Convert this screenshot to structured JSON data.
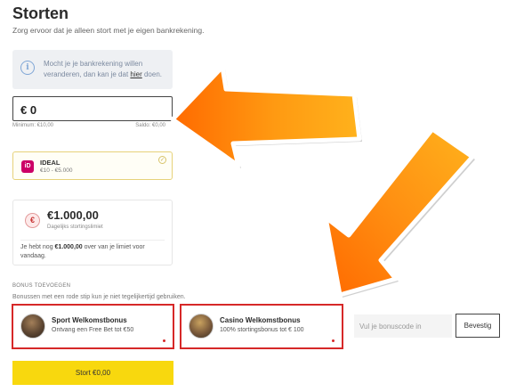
{
  "header": {
    "title": "Storten",
    "subtitle": "Zorg ervoor dat je alleen stort met je eigen bankrekening."
  },
  "info": {
    "text_before": "Mocht je je bankrekening willen veranderen, dan kan je dat ",
    "link": "hier",
    "text_after": " doen.",
    "icon": "info-icon"
  },
  "amount": {
    "value": "€ 0",
    "minimum": "Minimum: €10,00",
    "saldo": "Saldo: €0,00"
  },
  "payment_method": {
    "name": "IDEAL",
    "range": "€10 - €5.000",
    "icon": "ideal-logo-icon",
    "selected": true
  },
  "limit": {
    "icon_symbol": "€",
    "amount": "€1.000,00",
    "label": "Dagelijks stortingslimiet",
    "text_before": "Je hebt nog ",
    "text_bold": "€1.000,00",
    "text_after": " over van je limiet voor vandaag."
  },
  "bonus": {
    "heading": "BONUS TOEVOEGEN",
    "note": "Bonussen met een rode stip kun je niet tegelijkertijd gebruiken.",
    "items": [
      {
        "title": "Sport Welkomstbonus",
        "description": "Ontvang een Free Bet tot €50"
      },
      {
        "title": "Casino Welkomstbonus",
        "description": "100% stortingsbonus tot € 100"
      }
    ],
    "highlight_color": "#d62828"
  },
  "bonus_code": {
    "placeholder": "Vul je bonuscode in",
    "button": "Bevestig"
  },
  "submit": {
    "label": "Stort €0,00",
    "color": "#f8d80e"
  },
  "annotation_arrow_color": "#ff8c00"
}
